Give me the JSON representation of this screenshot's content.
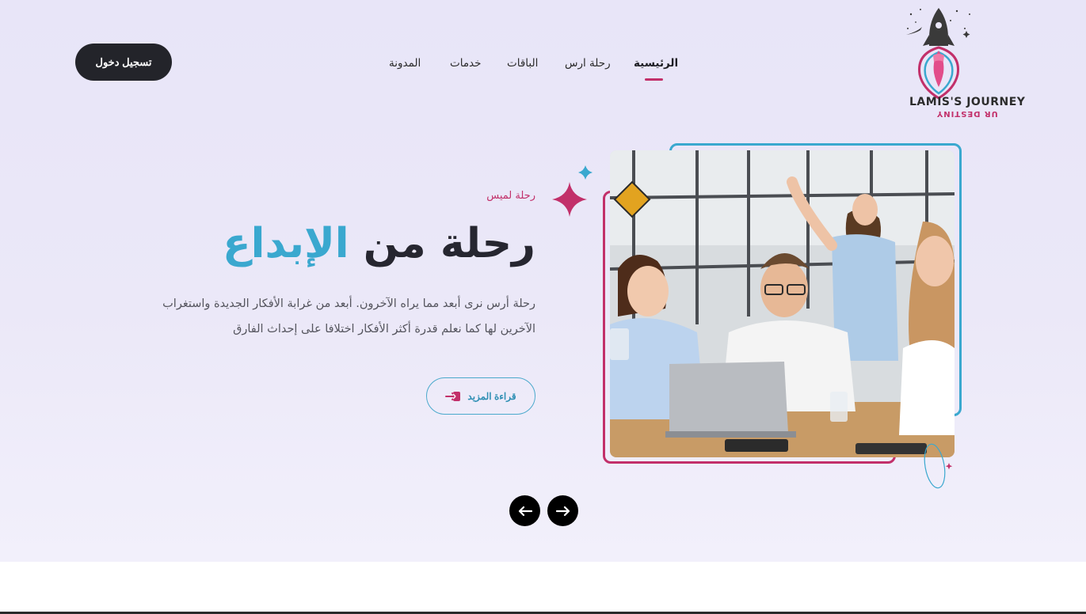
{
  "header": {
    "login_label": "تسجيل دخول",
    "nav": [
      {
        "label": "الرئيسية",
        "active": true
      },
      {
        "label": "رحلة ارس",
        "active": false
      },
      {
        "label": "الباقات",
        "active": false
      },
      {
        "label": "خدمات",
        "active": false
      },
      {
        "label": "المدونة",
        "active": false
      }
    ],
    "logo": {
      "title": "LAMIS'S JOURNEY",
      "subtitle": "UR DESTINY"
    }
  },
  "hero": {
    "kicker": "رحلة لميس",
    "headline_dark": "رحلة من",
    "headline_accent": "الإبداع",
    "description": "رحلة أرس نرى أبعد مما يراه الآخرون. أبعد من غرابة الأفكار الجديدة واستغراب الآخرين لها كما نعلم قدرة أكثر الأفكار اختلافا على إحداث الفارق",
    "read_more_label": "قراءة المزيد",
    "image_alt": "team celebrating around laptop"
  },
  "slider": {
    "prev_icon": "arrow-left-icon",
    "next_icon": "arrow-right-icon"
  },
  "colors": {
    "accent_blue": "#3aa8cf",
    "accent_pink": "#c2306a",
    "dark": "#23242a",
    "hero_bg": "#e9e6f8"
  }
}
